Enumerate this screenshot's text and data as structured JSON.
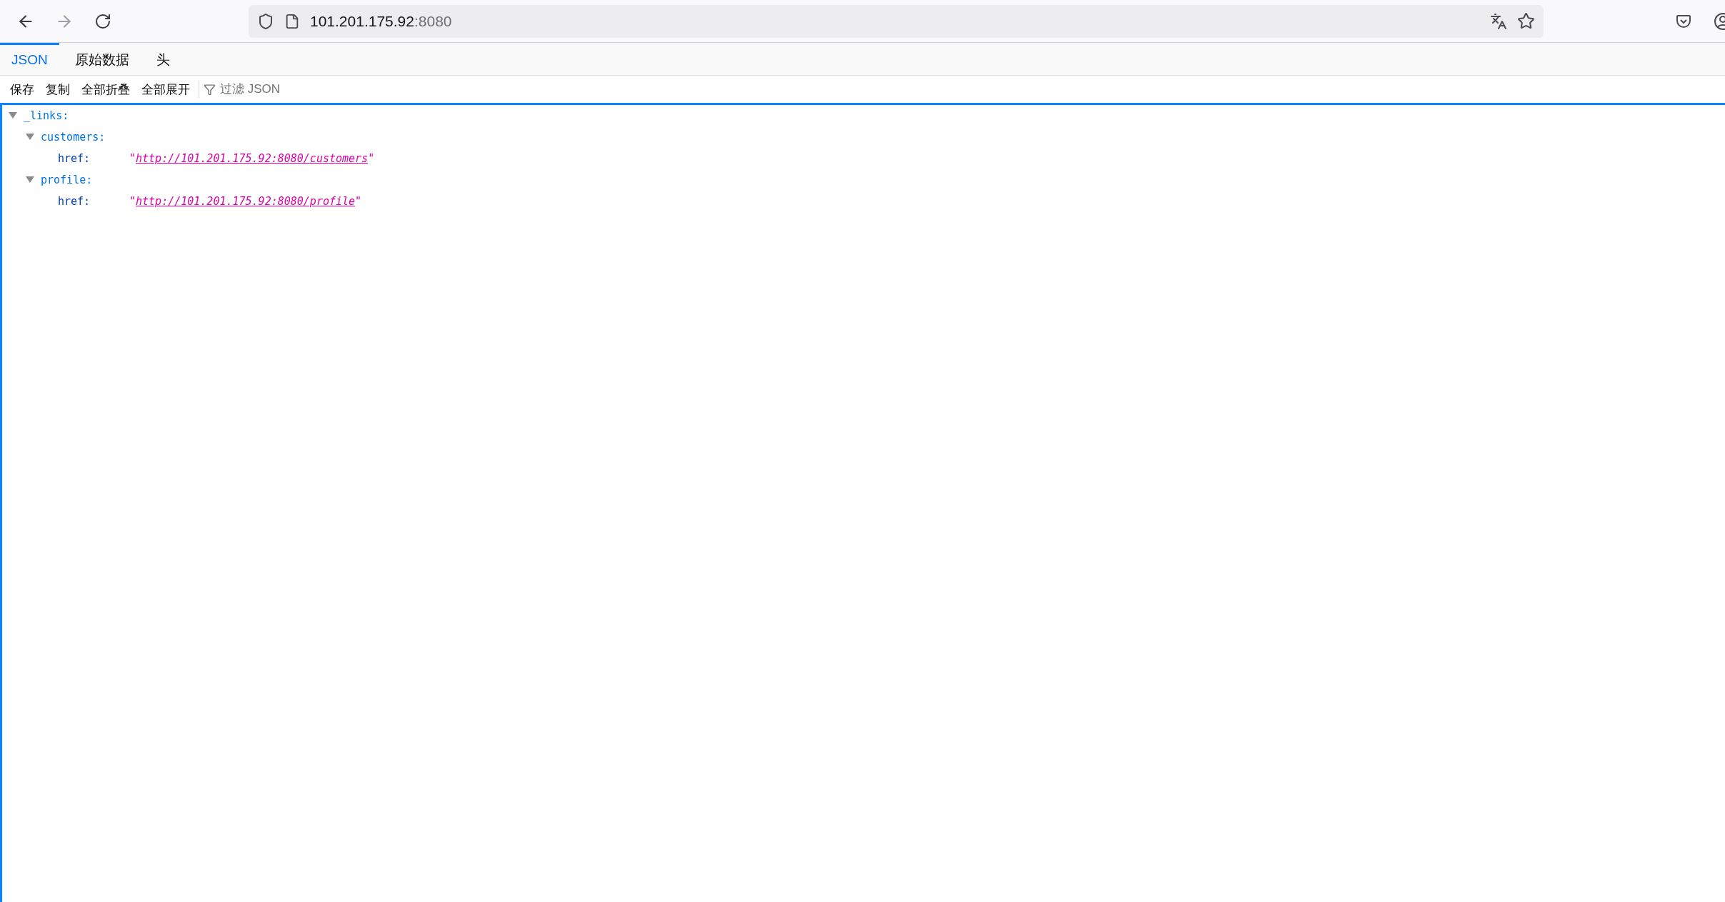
{
  "address_bar": {
    "host": "101.201.175.92",
    "port": ":8080"
  },
  "tabs": [
    {
      "label": "JSON",
      "selected": true
    },
    {
      "label": "原始数据",
      "selected": false
    },
    {
      "label": "头",
      "selected": false
    }
  ],
  "toolbar": {
    "buttons": [
      "保存",
      "复制",
      "全部折叠",
      "全部展开"
    ],
    "filter": {
      "placeholder": "过滤 JSON"
    }
  },
  "tree": [
    {
      "key": "_links:",
      "expanded": true,
      "children": [
        {
          "key": "customers:",
          "expanded": true,
          "children": [
            {
              "key": "href:",
              "quote_open": "\"",
              "link": "http://101.201.175.92:8080/customers",
              "quote_close": "\""
            }
          ]
        },
        {
          "key": "profile:",
          "expanded": true,
          "children": [
            {
              "key": "href:",
              "quote_open": "\"",
              "link": "http://101.201.175.92:8080/profile",
              "quote_close": "\""
            }
          ]
        }
      ]
    }
  ]
}
